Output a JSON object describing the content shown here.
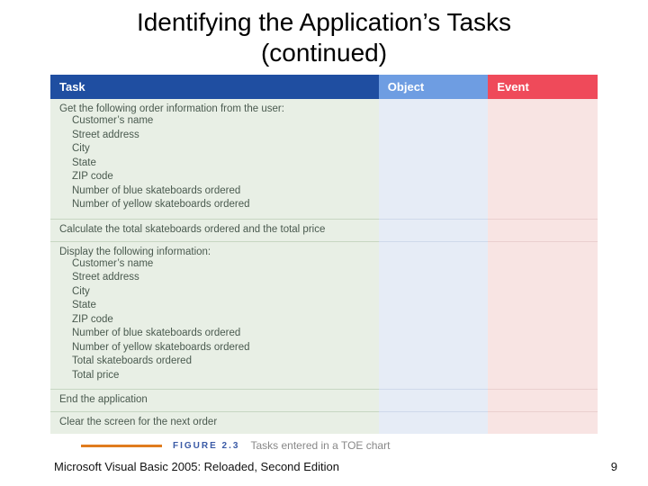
{
  "title_line1": "Identifying the Application’s Tasks",
  "title_line2": "(continued)",
  "headers": {
    "task": "Task",
    "object": "Object",
    "event": "Event"
  },
  "rows": [
    {
      "lead": "Get the following order information from the user:",
      "items": [
        "Customer’s name",
        "Street address",
        "City",
        "State",
        "ZIP code",
        "Number of blue skateboards ordered",
        "Number of yellow skateboards ordered"
      ],
      "object": "",
      "event": ""
    },
    {
      "lead": "Calculate the total skateboards ordered and the total price",
      "items": [],
      "object": "",
      "event": ""
    },
    {
      "lead": "Display the following information:",
      "items": [
        "Customer’s name",
        "Street address",
        "City",
        "State",
        "ZIP code",
        "Number of blue skateboards ordered",
        "Number of yellow skateboards ordered",
        "Total skateboards ordered",
        "Total price"
      ],
      "object": "",
      "event": ""
    },
    {
      "lead": "End the application",
      "items": [],
      "object": "",
      "event": ""
    },
    {
      "lead": "Clear the screen for the next order",
      "items": [],
      "object": "",
      "event": ""
    }
  ],
  "figure_label": "FIGURE 2.3",
  "figure_caption": "Tasks entered in a TOE chart",
  "footer_left": "Microsoft Visual Basic 2005: Reloaded, Second Edition",
  "footer_right": "9",
  "chart_data": {
    "type": "table",
    "title": "Tasks entered in a TOE chart",
    "columns": [
      "Task",
      "Object",
      "Event"
    ],
    "rows": [
      [
        "Get the following order information from the user: Customer’s name; Street address; City; State; ZIP code; Number of blue skateboards ordered; Number of yellow skateboards ordered",
        "",
        ""
      ],
      [
        "Calculate the total skateboards ordered and the total price",
        "",
        ""
      ],
      [
        "Display the following information: Customer’s name; Street address; City; State; ZIP code; Number of blue skateboards ordered; Number of yellow skateboards ordered; Total skateboards ordered; Total price",
        "",
        ""
      ],
      [
        "End the application",
        "",
        ""
      ],
      [
        "Clear the screen for the next order",
        "",
        ""
      ]
    ]
  }
}
